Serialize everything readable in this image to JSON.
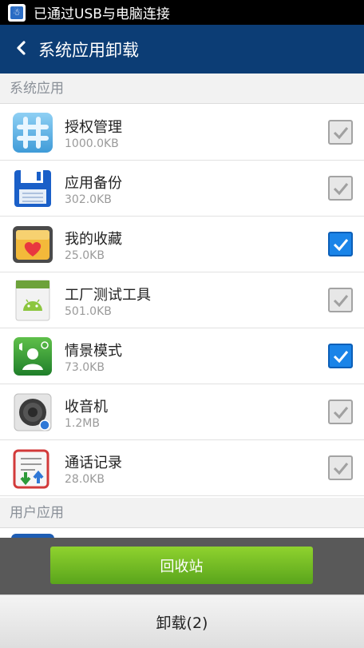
{
  "status_bar": {
    "notification": "已通过USB与电脑连接",
    "icon": "usb-debug-icon"
  },
  "header": {
    "back_icon": "chevron-left-icon",
    "title": "系统应用卸载"
  },
  "sections": {
    "system": "系统应用",
    "user": "用户应用"
  },
  "apps": [
    {
      "name": "授权管理",
      "size": "1000.0KB",
      "icon": "hash-grid-icon",
      "checked": false
    },
    {
      "name": "应用备份",
      "size": "302.0KB",
      "icon": "floppy-disk-icon",
      "checked": false
    },
    {
      "name": "我的收藏",
      "size": "25.0KB",
      "icon": "heart-folder-icon",
      "checked": true
    },
    {
      "name": "工厂测试工具",
      "size": "501.0KB",
      "icon": "android-icon",
      "checked": false
    },
    {
      "name": "情景模式",
      "size": "73.0KB",
      "icon": "scene-mode-icon",
      "checked": true
    },
    {
      "name": "收音机",
      "size": "1.2MB",
      "icon": "radio-speaker-icon",
      "checked": false
    },
    {
      "name": "通话记录",
      "size": "28.0KB",
      "icon": "call-log-icon",
      "checked": false
    }
  ],
  "buttons": {
    "recycle": "回收站",
    "uninstall": "卸载(2)"
  },
  "colors": {
    "header": "#0c3d75",
    "checked": "#1a84e8",
    "recycle_button": "#7ac424"
  }
}
